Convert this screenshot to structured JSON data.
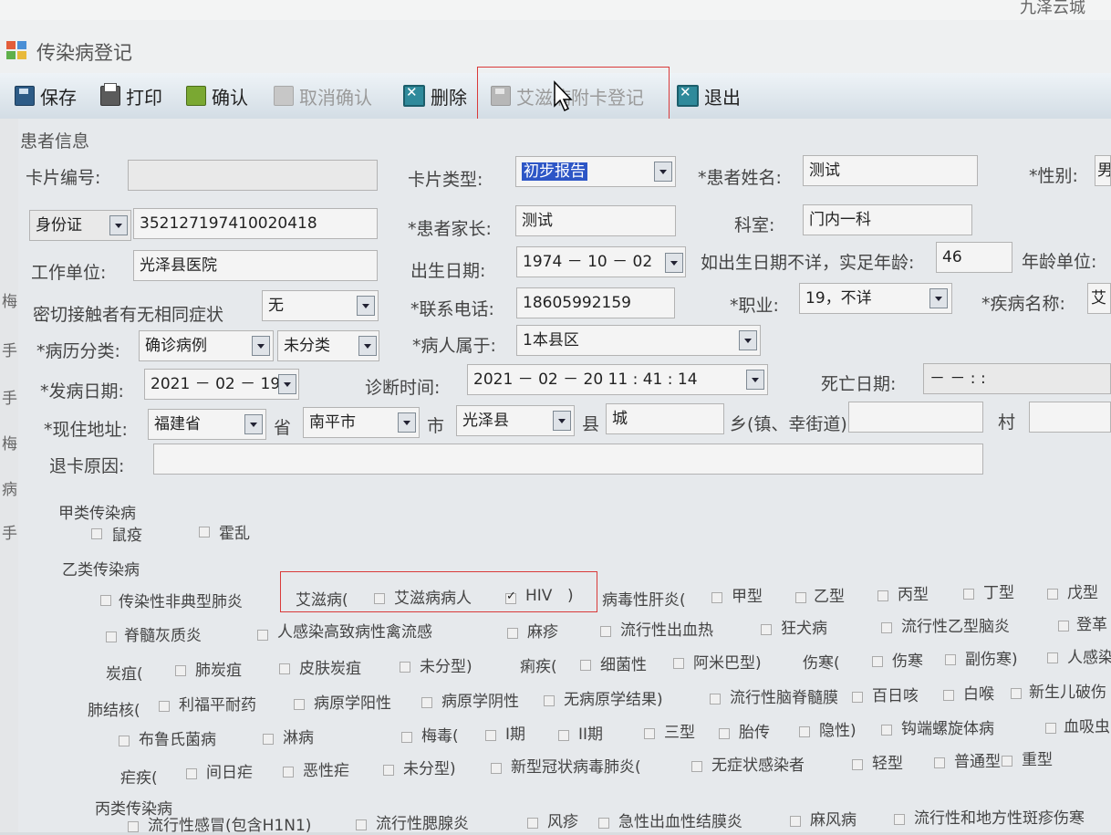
{
  "topstrip": {
    "text": "九泽云城"
  },
  "window": {
    "title": "传染病登记"
  },
  "toolbar": {
    "save": "保存",
    "print": "打印",
    "confirm": "确认",
    "cancel_confirm": "取消确认",
    "delete": "删除",
    "aids_card": "艾滋病附卡登记",
    "exit": "退出"
  },
  "left_side_chars": [
    "梅",
    "手",
    "手",
    "梅",
    "病",
    "手"
  ],
  "group_title": "患者信息",
  "form": {
    "card_no_label": "卡片编号:",
    "card_no": "",
    "card_type_label": "卡片类型:",
    "card_type": "初步报告",
    "patient_name_label": "*患者姓名:",
    "patient_name": "测试",
    "sex_label": "*性别:",
    "sex": "男",
    "id_type": "身份证",
    "id_no": "352127197410020418",
    "guardian_label": "*患者家长:",
    "guardian": "测试",
    "dept_label": "科室:",
    "dept": "门内一科",
    "work_unit_label": "工作单位:",
    "work_unit": "光泽县医院",
    "birth_label": "出生日期:",
    "birth": "1974 － 10 － 02",
    "age_label": "如出生日期不详，实足年龄:",
    "age": "46",
    "age_unit_label": "年龄单位:",
    "contact_label": "密切接触者有无相同症状",
    "contact": "无",
    "phone_label": "*联系电话:",
    "phone": "18605992159",
    "job_label": "*职业:",
    "job": "19，不详",
    "disease_label": "*疾病名称:",
    "disease": "艾",
    "case_type_label": "*病历分类:",
    "case_type": "确诊病例",
    "case_type2": "未分类",
    "belong_label": "*病人属于:",
    "belong": "1本县区",
    "onset_label": "*发病日期:",
    "onset": "2021 － 02 － 19",
    "diag_label": "诊断时间:",
    "diag": "2021 － 02 － 20   11 : 41 : 14",
    "death_label": "死亡日期:",
    "death": "－  －          :  :",
    "addr_label": "*现住地址:",
    "province": "福建省",
    "province_unit": "省",
    "city": "南平市",
    "city_unit": "市",
    "county": "光泽县",
    "county_unit": "县",
    "town": "城",
    "town_unit": "乡(镇、幸街道)",
    "village_unit": "村",
    "return_label": "退卡原因:",
    "return_reason": ""
  },
  "sections": {
    "a_title": "甲类传染病",
    "a_items": [
      "鼠疫",
      "霍乱"
    ],
    "b_title": "乙类传染病",
    "b_row1": [
      "传染性非典型肺炎",
      "艾滋病(",
      "艾滋病病人",
      "HIV",
      ")",
      "病毒性肝炎(",
      "甲型",
      "乙型",
      "丙型",
      "丁型",
      "戊型"
    ],
    "b_row2": [
      "脊髓灰质炎",
      "人感染高致病性禽流感",
      "麻疹",
      "流行性出血热",
      "狂犬病",
      "流行性乙型脑炎",
      "登革"
    ],
    "b_row3": [
      "炭疽(",
      "肺炭疽",
      "皮肤炭疽",
      "未分型)",
      "痢疾(",
      "细菌性",
      "阿米巴型)",
      "伤寒(",
      "伤寒",
      "副伤寒)",
      "人感染"
    ],
    "b_row4": [
      "肺结核(",
      "利福平耐药",
      "病原学阳性",
      "病原学阴性",
      "无病原学结果)",
      "流行性脑脊髓膜",
      "百日咳",
      "白喉",
      "新生儿破伤"
    ],
    "b_row5": [
      "布鲁氏菌病",
      "淋病",
      "梅毒(",
      "I期",
      "II期",
      "三型",
      "胎传",
      "隐性)",
      "钩端螺旋体病",
      "血吸虫"
    ],
    "b_row6": [
      "疟疾(",
      "间日疟",
      "恶性疟",
      "未分型)",
      "新型冠状病毒肺炎(",
      "无症状感染者",
      "轻型",
      "普通型",
      "重型"
    ],
    "c_title": "丙类传染病",
    "c_row1": [
      "流行性感冒(包含H1N1)",
      "流行性腮腺炎",
      "风疹",
      "急性出血性结膜炎",
      "麻风病",
      "流行性和地方性斑疹伤寒"
    ]
  }
}
